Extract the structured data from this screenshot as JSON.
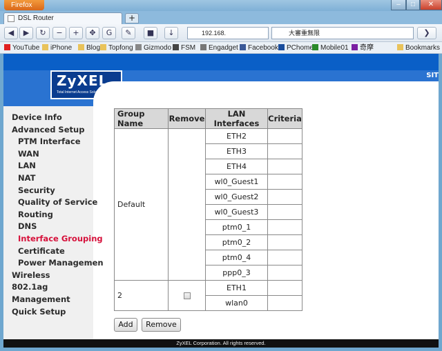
{
  "browser": {
    "app_button": "Firefox",
    "tab_title": "DSL Router",
    "new_tab": "+",
    "url": "192.168.",
    "search_text": "大審重無限",
    "window_controls": [
      "–",
      "□",
      "✕"
    ]
  },
  "bookmarks": [
    {
      "label": "YouTube",
      "color": "#e02020"
    },
    {
      "label": "iPhone",
      "color": "#e9c35a"
    },
    {
      "label": "Blog",
      "color": "#e9c35a"
    },
    {
      "label": "Topfong",
      "color": "#e9c35a"
    },
    {
      "label": "Gizmodo",
      "color": "#888888"
    },
    {
      "label": "FSM",
      "color": "#444444"
    },
    {
      "label": "Engadget",
      "color": "#777777"
    },
    {
      "label": "Facebook",
      "color": "#3b5998"
    },
    {
      "label": "PChome",
      "color": "#1a4d9c"
    },
    {
      "label": "Mobile01",
      "color": "#2a8a2a"
    },
    {
      "label": "奇摩",
      "color": "#7a1fa2"
    },
    {
      "label": "Bookmarks",
      "color": "#e9c35a"
    }
  ],
  "header": {
    "logo": "ZyXEL",
    "logo_sub": "Total Internet Access Solution",
    "sitemap": "SIT"
  },
  "sidebar": {
    "items": [
      {
        "label": "Device Info",
        "level": 1
      },
      {
        "label": "Advanced Setup",
        "level": 1
      },
      {
        "label": "PTM Interface",
        "level": 2
      },
      {
        "label": "WAN",
        "level": 2
      },
      {
        "label": "LAN",
        "level": 2
      },
      {
        "label": "NAT",
        "level": 2
      },
      {
        "label": "Security",
        "level": 2
      },
      {
        "label": "Quality of Service",
        "level": 2
      },
      {
        "label": "Routing",
        "level": 2
      },
      {
        "label": "DNS",
        "level": 2
      },
      {
        "label": "Interface Grouping",
        "level": 2,
        "active": true
      },
      {
        "label": "Certificate",
        "level": 2
      },
      {
        "label": "Power Managemen",
        "level": 2
      },
      {
        "label": "Wireless",
        "level": 1
      },
      {
        "label": "802.1ag",
        "level": 1
      },
      {
        "label": "Management",
        "level": 1
      },
      {
        "label": "Quick Setup",
        "level": 1
      }
    ]
  },
  "table": {
    "headers": [
      "Group Name",
      "Remove",
      "LAN Interfaces",
      "Criteria"
    ],
    "groups": [
      {
        "name": "Default",
        "removable": false,
        "interfaces": [
          "ETH2",
          "ETH3",
          "ETH4",
          "wl0_Guest1",
          "wl0_Guest2",
          "wl0_Guest3",
          "ptm0_1",
          "ptm0_2",
          "ptm0_4",
          "ppp0_3"
        ]
      },
      {
        "name": "2",
        "removable": true,
        "interfaces": [
          "ETH1",
          "wlan0"
        ]
      }
    ]
  },
  "buttons": {
    "add": "Add",
    "remove": "Remove"
  },
  "footer": "ZyXEL Corporation. All rights reserved.",
  "colors": {
    "accent": "#0a5fc7",
    "active_menu": "#d6113b"
  }
}
